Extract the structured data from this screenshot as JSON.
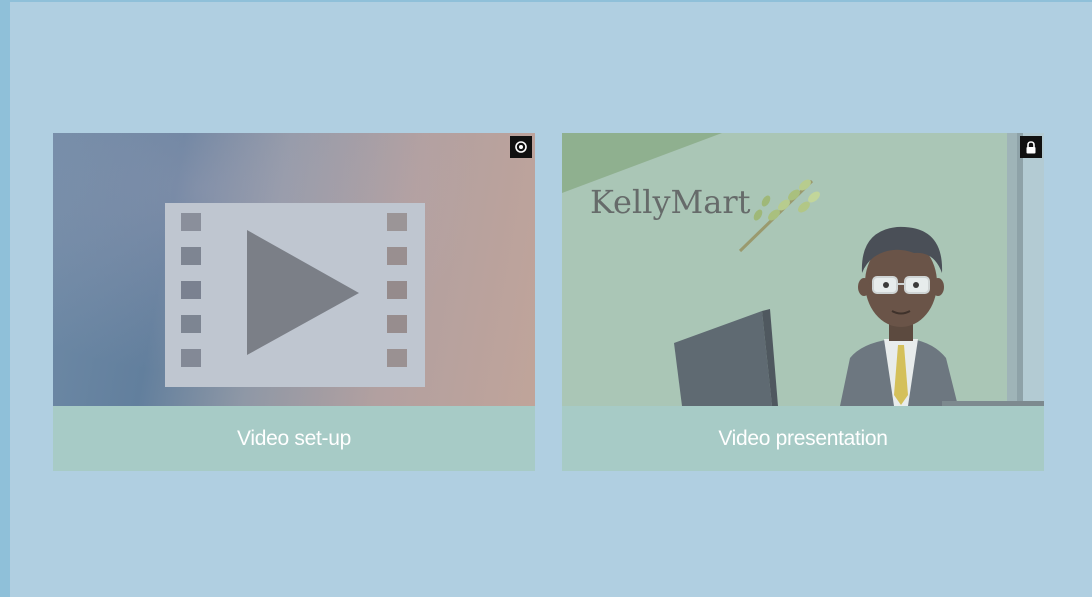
{
  "cards": [
    {
      "caption": "Video set-up",
      "icon": "record-icon",
      "thumbnail": "video-placeholder"
    },
    {
      "caption": "Video presentation",
      "icon": "lock-icon",
      "thumbnail": "kellymart-presenter",
      "logo_text": "KellyMart"
    }
  ],
  "colors": {
    "page_background": "#b0cfe1",
    "caption_background": "#a7cbc6",
    "caption_text": "#ffffff",
    "icon_badge": "#111111"
  }
}
